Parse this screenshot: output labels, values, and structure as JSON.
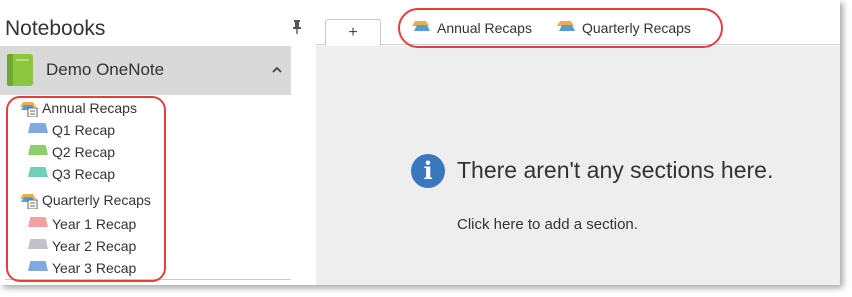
{
  "notebooks": {
    "title": "Notebooks",
    "notebook": {
      "name": "Demo OneNote",
      "color": "#8cc63f"
    },
    "groups": [
      {
        "label": "Annual Recaps",
        "sections": [
          {
            "label": "Q1 Recap",
            "color": "#7fa9e0"
          },
          {
            "label": "Q2 Recap",
            "color": "#8fcf6a"
          },
          {
            "label": "Q3 Recap",
            "color": "#6fd0b8"
          }
        ]
      },
      {
        "label": "Quarterly Recaps",
        "sections": [
          {
            "label": "Year 1 Recap",
            "color": "#f2a0a0"
          },
          {
            "label": "Year 2 Recap",
            "color": "#bfc3c7"
          },
          {
            "label": "Year 3 Recap",
            "color": "#7fa9e0"
          }
        ]
      }
    ]
  },
  "tabbar": {
    "add_label": "+",
    "group_tabs": [
      {
        "label": "Annual Recaps"
      },
      {
        "label": "Quarterly Recaps"
      }
    ]
  },
  "main": {
    "empty_title": "There aren't any sections here.",
    "add_hint": "Click here to add a section.",
    "info_glyph": "i"
  },
  "colors": {
    "accent_blue": "#3a78bd",
    "annotation_red": "#e0403f",
    "group_icon_top": "#e7b04b",
    "group_icon_mid": "#5b9bd5"
  }
}
